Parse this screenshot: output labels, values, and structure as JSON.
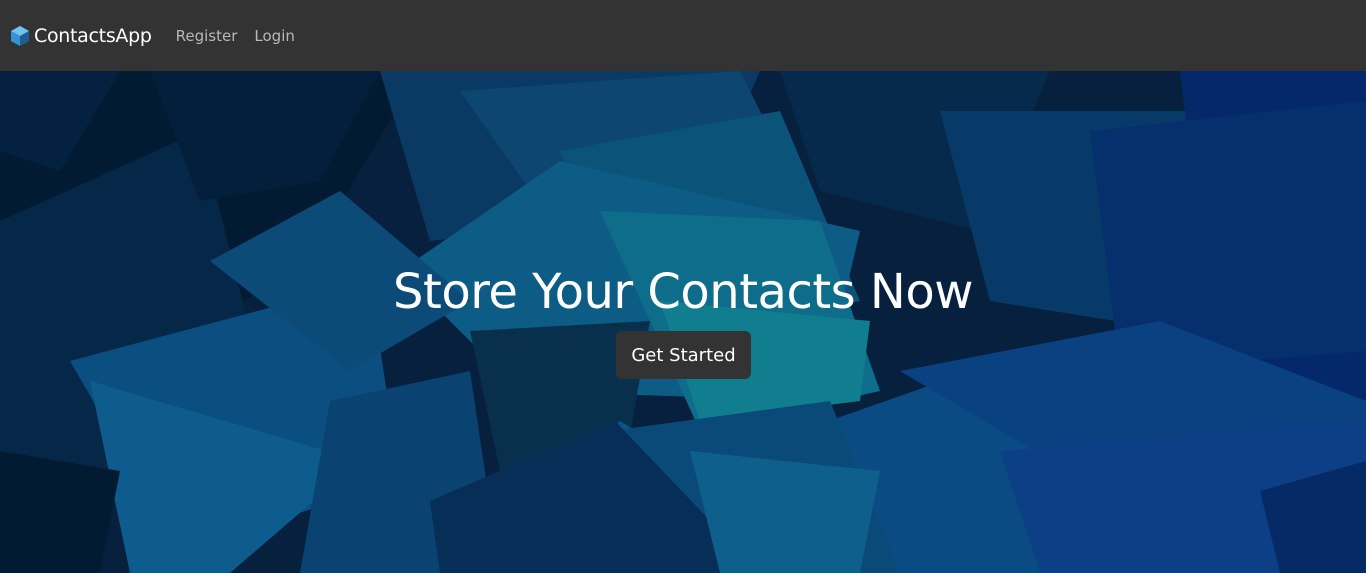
{
  "navbar": {
    "brand": "ContactsApp",
    "links": [
      {
        "label": "Register"
      },
      {
        "label": "Login"
      }
    ]
  },
  "hero": {
    "title": "Store Your Contacts Now",
    "button_label": "Get Started"
  },
  "colors": {
    "navbar_bg": "#333333",
    "button_bg": "#333333",
    "hero_base": "#06203d",
    "nav_link": "#b9b9b9"
  },
  "icons": {
    "brand": "cube-icon"
  }
}
